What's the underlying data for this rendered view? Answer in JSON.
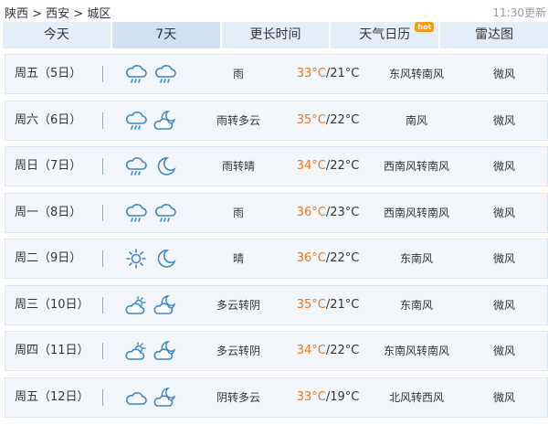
{
  "breadcrumb": "陕西 > 西安 > 城区",
  "updated": "11:30更新",
  "tabs": [
    "今天",
    "7天",
    "更长时间",
    "天气日历",
    "雷达图"
  ],
  "hot_badge": "hot",
  "colors": {
    "hi_temp": "#e8761c",
    "tab_bg": "#e4eef9",
    "row_bg": "#f3f7fb",
    "hot": "#f39a16"
  },
  "days": [
    {
      "date": "周五（5日）",
      "icons": [
        "rain-cloud-icon",
        "rain-cloud-icon"
      ],
      "weather": "雨",
      "hi": "33°C",
      "lo": "/21°C",
      "wind": "东风转南风",
      "level": "微风"
    },
    {
      "date": "周六（6日）",
      "icons": [
        "rain-cloud-icon",
        "cloud-moon-icon"
      ],
      "weather": "雨转多云",
      "hi": "35°C",
      "lo": "/22°C",
      "wind": "南风",
      "level": "微风"
    },
    {
      "date": "周日（7日）",
      "icons": [
        "rain-cloud-icon",
        "moon-icon"
      ],
      "weather": "雨转晴",
      "hi": "34°C",
      "lo": "/22°C",
      "wind": "西南风转南风",
      "level": "微风"
    },
    {
      "date": "周一（8日）",
      "icons": [
        "rain-cloud-icon",
        "rain-cloud-icon"
      ],
      "weather": "雨",
      "hi": "36°C",
      "lo": "/23°C",
      "wind": "西南风转南风",
      "level": "微风"
    },
    {
      "date": "周二（9日）",
      "icons": [
        "sun-icon",
        "moon-icon"
      ],
      "weather": "晴",
      "hi": "36°C",
      "lo": "/22°C",
      "wind": "东南风",
      "level": "微风"
    },
    {
      "date": "周三（10日）",
      "icons": [
        "sun-cloud-icon",
        "cloud-moon-icon"
      ],
      "weather": "多云转阴",
      "hi": "35°C",
      "lo": "/21°C",
      "wind": "东南风",
      "level": "微风"
    },
    {
      "date": "周四（11日）",
      "icons": [
        "sun-cloud-icon",
        "cloud-moon-icon"
      ],
      "weather": "多云转阴",
      "hi": "34°C",
      "lo": "/22°C",
      "wind": "东南风转南风",
      "level": "微风"
    },
    {
      "date": "周五（12日）",
      "icons": [
        "cloud-icon",
        "cloud-moon-icon"
      ],
      "weather": "阴转多云",
      "hi": "33°C",
      "lo": "/19°C",
      "wind": "北风转西风",
      "level": "微风"
    }
  ]
}
